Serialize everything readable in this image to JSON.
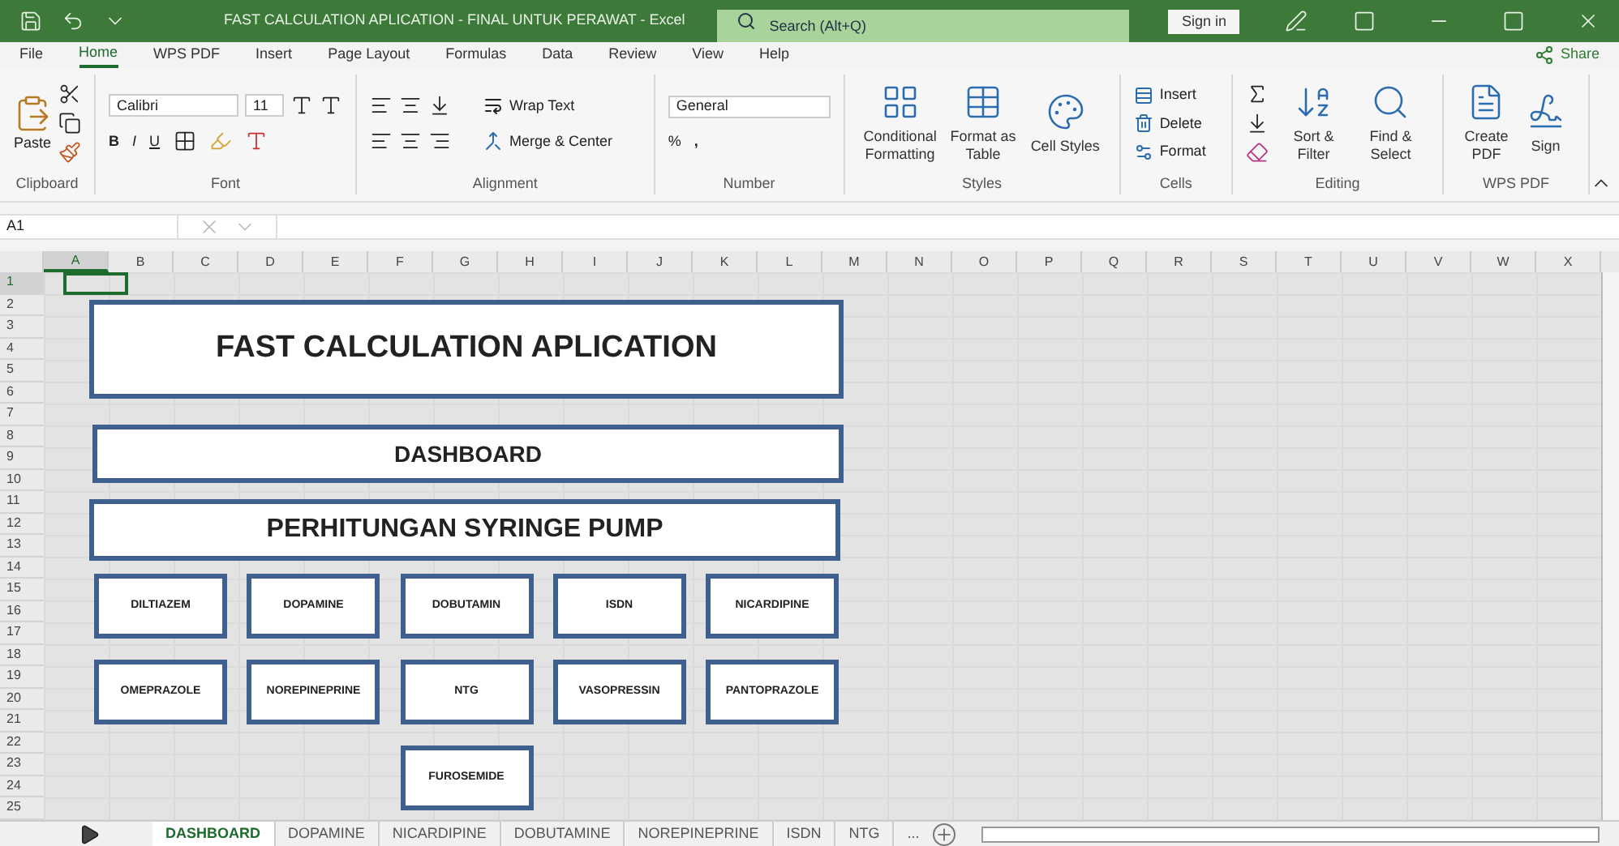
{
  "title_bar": {
    "title": "FAST CALCULATION APLICATION - FINAL UNTUK PERAWAT - Excel",
    "search_placeholder": "Search (Alt+Q)",
    "sign_in": "Sign in"
  },
  "menu_tabs": [
    {
      "label": "File",
      "selected": false
    },
    {
      "label": "Home",
      "selected": true
    },
    {
      "label": "WPS PDF",
      "selected": false
    },
    {
      "label": "Insert",
      "selected": false
    },
    {
      "label": "Page Layout",
      "selected": false
    },
    {
      "label": "Formulas",
      "selected": false
    },
    {
      "label": "Data",
      "selected": false
    },
    {
      "label": "Review",
      "selected": false
    },
    {
      "label": "View",
      "selected": false
    },
    {
      "label": "Help",
      "selected": false
    }
  ],
  "share": "Share",
  "ribbon": {
    "clipboard": {
      "name": "Clipboard",
      "paste": "Paste"
    },
    "font": {
      "name": "Font",
      "family": "Calibri",
      "size": "11",
      "bold": "B",
      "italic": "I",
      "underline": "U"
    },
    "alignment": {
      "name": "Alignment",
      "wrap": "Wrap Text",
      "merge": "Merge & Center"
    },
    "number": {
      "name": "Number",
      "format": "General",
      "percent": "%",
      "comma": ","
    },
    "styles": {
      "name": "Styles",
      "items": [
        "Conditional Formatting",
        "Format as Table",
        "Cell Styles"
      ]
    },
    "cells": {
      "name": "Cells",
      "items": [
        "Insert",
        "Delete",
        "Format"
      ]
    },
    "editing": {
      "name": "Editing",
      "items": [
        "Sort & Filter",
        "Find & Select"
      ]
    },
    "wps": {
      "name": "WPS PDF",
      "items": [
        "Create PDF",
        "Sign"
      ]
    }
  },
  "formula_bar": {
    "name_box": "A1"
  },
  "columns": [
    {
      "label": "A",
      "selected": true
    },
    {
      "label": "B",
      "selected": false
    },
    {
      "label": "C",
      "selected": false
    },
    {
      "label": "D",
      "selected": false
    },
    {
      "label": "E",
      "selected": false
    },
    {
      "label": "F",
      "selected": false
    },
    {
      "label": "G",
      "selected": false
    },
    {
      "label": "H",
      "selected": false
    },
    {
      "label": "I",
      "selected": false
    },
    {
      "label": "J",
      "selected": false
    },
    {
      "label": "K",
      "selected": false
    },
    {
      "label": "L",
      "selected": false
    },
    {
      "label": "M",
      "selected": false
    },
    {
      "label": "N",
      "selected": false
    },
    {
      "label": "O",
      "selected": false
    },
    {
      "label": "P",
      "selected": false
    },
    {
      "label": "Q",
      "selected": false
    },
    {
      "label": "R",
      "selected": false
    },
    {
      "label": "S",
      "selected": false
    },
    {
      "label": "T",
      "selected": false
    },
    {
      "label": "U",
      "selected": false
    },
    {
      "label": "V",
      "selected": false
    },
    {
      "label": "W",
      "selected": false
    },
    {
      "label": "X",
      "selected": false
    }
  ],
  "rows": [
    {
      "label": "1",
      "selected": true
    },
    {
      "label": "2",
      "selected": false
    },
    {
      "label": "3",
      "selected": false
    },
    {
      "label": "4",
      "selected": false
    },
    {
      "label": "5",
      "selected": false
    },
    {
      "label": "6",
      "selected": false
    },
    {
      "label": "7",
      "selected": false
    },
    {
      "label": "8",
      "selected": false
    },
    {
      "label": "9",
      "selected": false
    },
    {
      "label": "10",
      "selected": false
    },
    {
      "label": "11",
      "selected": false
    },
    {
      "label": "12",
      "selected": false
    },
    {
      "label": "13",
      "selected": false
    },
    {
      "label": "14",
      "selected": false
    },
    {
      "label": "15",
      "selected": false
    },
    {
      "label": "16",
      "selected": false
    },
    {
      "label": "17",
      "selected": false
    },
    {
      "label": "18",
      "selected": false
    },
    {
      "label": "19",
      "selected": false
    },
    {
      "label": "20",
      "selected": false
    },
    {
      "label": "21",
      "selected": false
    },
    {
      "label": "22",
      "selected": false
    },
    {
      "label": "23",
      "selected": false
    },
    {
      "label": "24",
      "selected": false
    },
    {
      "label": "25",
      "selected": false
    }
  ],
  "shapes": {
    "title": "FAST CALCULATION APLICATION",
    "dashboard": "DASHBOARD",
    "section": "PERHITUNGAN SYRINGE PUMP",
    "button_rows": [
      [
        "DILTIAZEM",
        "DOPAMINE",
        "DOBUTAMIN",
        "ISDN",
        "NICARDIPINE"
      ],
      [
        "OMEPRAZOLE",
        "NOREPINEPRINE",
        "NTG",
        "VASOPRESSIN",
        "PANTOPRAZOLE"
      ],
      [
        "FUROSEMIDE"
      ]
    ]
  },
  "sheet_tabs": [
    {
      "label": "DASHBOARD",
      "selected": true
    },
    {
      "label": "DOPAMINE",
      "selected": false
    },
    {
      "label": "NICARDIPINE",
      "selected": false
    },
    {
      "label": "DOBUTAMINE",
      "selected": false
    },
    {
      "label": "NOREPINEPRINE",
      "selected": false
    },
    {
      "label": "ISDN",
      "selected": false
    },
    {
      "label": "NTG",
      "selected": false
    }
  ],
  "more_tabs": "..."
}
